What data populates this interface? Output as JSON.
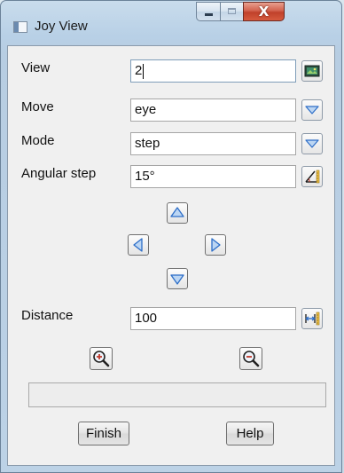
{
  "window": {
    "title": "Joy View",
    "close_glyph": "X"
  },
  "fields": {
    "view": {
      "label": "View",
      "value": "2"
    },
    "move": {
      "label": "Move",
      "value": "eye"
    },
    "mode": {
      "label": "Mode",
      "value": "step"
    },
    "angular_step": {
      "label": "Angular step",
      "value": "15°"
    },
    "distance": {
      "label": "Distance",
      "value": "100"
    }
  },
  "status_text": "",
  "buttons": {
    "finish": "Finish",
    "help": "Help"
  },
  "icons": {
    "view_picker": "view-picker-icon",
    "dropdown": "chevron-down-icon",
    "angle_picker": "angle-picker-icon",
    "distance_picker": "distance-picker-icon",
    "up": "arrow-up-icon",
    "down": "arrow-down-icon",
    "left": "arrow-left-icon",
    "right": "arrow-right-icon",
    "zoom_in": "zoom-in-icon",
    "zoom_out": "zoom-out-icon"
  },
  "colors": {
    "titlebar": "#b8d0e6",
    "close_button": "#c8472f",
    "client_bg": "#f0f0f0",
    "icon_blue": "#2d6ec8"
  }
}
